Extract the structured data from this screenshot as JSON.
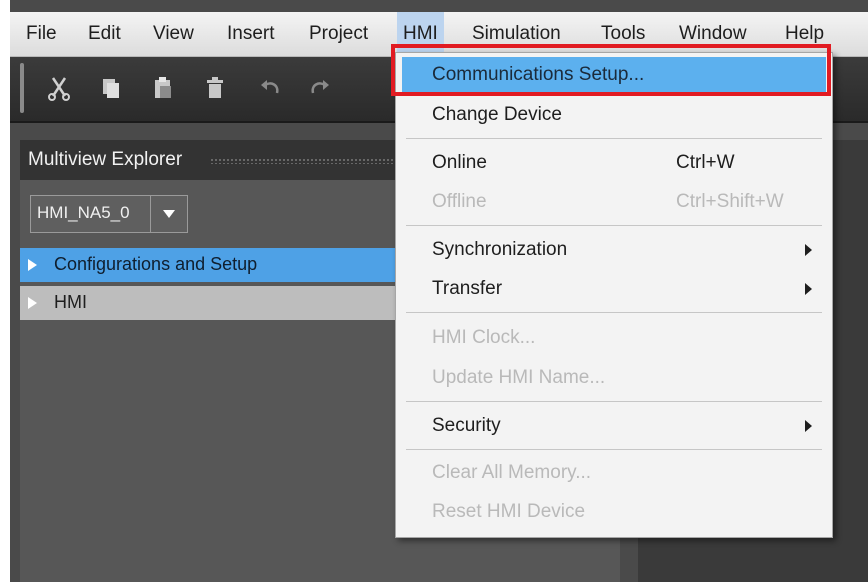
{
  "menubar": {
    "items": [
      "File",
      "Edit",
      "View",
      "Insert",
      "Project",
      "HMI",
      "Simulation",
      "Tools",
      "Window",
      "Help"
    ]
  },
  "toolbar": {
    "icons": [
      "cut-icon",
      "copy-icon",
      "paste-icon",
      "delete-icon",
      "undo-icon",
      "redo-icon"
    ]
  },
  "explorer": {
    "title": "Multiview Explorer",
    "device": "HMI_NA5_0",
    "tree": [
      "Configurations and Setup",
      "HMI"
    ]
  },
  "hmi_menu": {
    "items": [
      {
        "label": "Communications Setup...",
        "shortcut": "",
        "enabled": true,
        "highlighted": true
      },
      {
        "label": "Change Device",
        "shortcut": "",
        "enabled": true
      },
      {
        "label": "Online",
        "shortcut": "Ctrl+W",
        "enabled": true
      },
      {
        "label": "Offline",
        "shortcut": "Ctrl+Shift+W",
        "enabled": false
      },
      {
        "label": "Synchronization",
        "shortcut": "",
        "enabled": true,
        "submenu": true
      },
      {
        "label": "Transfer",
        "shortcut": "",
        "enabled": true,
        "submenu": true
      },
      {
        "label": "HMI Clock...",
        "shortcut": "",
        "enabled": false
      },
      {
        "label": "Update HMI Name...",
        "shortcut": "",
        "enabled": false
      },
      {
        "label": "Security",
        "shortcut": "",
        "enabled": true,
        "submenu": true
      },
      {
        "label": "Clear All Memory...",
        "shortcut": "",
        "enabled": false
      },
      {
        "label": "Reset HMI Device",
        "shortcut": "",
        "enabled": false
      }
    ]
  },
  "colors": {
    "highlight": "#5cb0ee",
    "callout": "#e11b22",
    "tree_selected": "#4ea1e6"
  }
}
